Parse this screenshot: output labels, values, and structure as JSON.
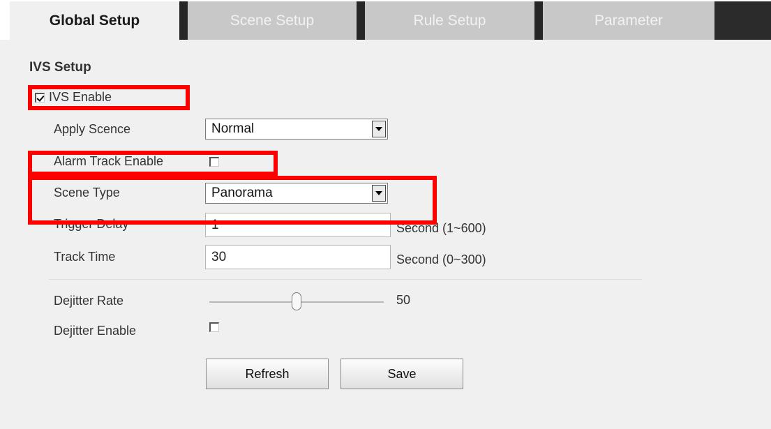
{
  "tabs": [
    {
      "label": "Global Setup",
      "active": true
    },
    {
      "label": "Scene Setup",
      "active": false
    },
    {
      "label": "Rule Setup",
      "active": false
    },
    {
      "label": "Parameter",
      "active": false
    }
  ],
  "section_title": "IVS Setup",
  "ivs_enable": {
    "label": "IVS Enable",
    "checked": true
  },
  "apply_scene": {
    "label": "Apply Scence",
    "value": "Normal"
  },
  "alarm_track": {
    "label": "Alarm Track Enable",
    "checked": false
  },
  "scene_type": {
    "label": "Scene Type",
    "value": "Panorama"
  },
  "trigger_delay": {
    "label": "Trigger Delay",
    "value": "1",
    "unit": "Second (1~600)"
  },
  "track_time": {
    "label": "Track Time",
    "value": "30",
    "unit": "Second (0~300)"
  },
  "dejitter_rate": {
    "label": "Dejitter Rate",
    "value": "50"
  },
  "dejitter_enable": {
    "label": "Dejitter Enable",
    "checked": false
  },
  "buttons": {
    "refresh": "Refresh",
    "save": "Save"
  },
  "colors": {
    "highlight": "#ff0000",
    "tab_inactive": "#c8c8c8",
    "tab_separator": "#262626",
    "background": "#f0f0f0"
  }
}
